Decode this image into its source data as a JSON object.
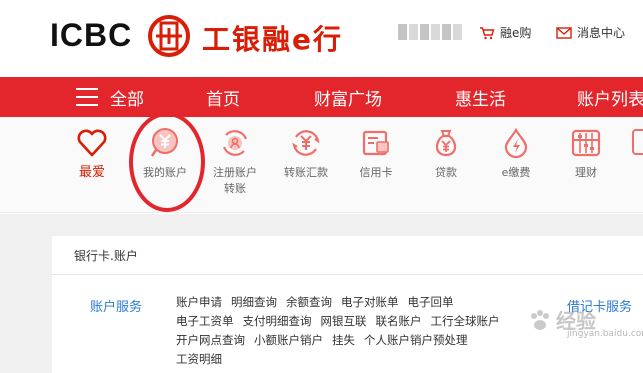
{
  "header": {
    "logo_text": "ICBC",
    "brand_cn": "工银融e行",
    "mall_link": "融e购",
    "messages_link": "消息中心"
  },
  "nav": {
    "all_label": "全部",
    "items": [
      "首页",
      "财富广场",
      "惠生活",
      "账户列表"
    ]
  },
  "quick_icons": [
    {
      "label": "最爱",
      "icon": "heart-icon"
    },
    {
      "label": "我的账户",
      "icon": "yuan-search-icon"
    },
    {
      "label": "注册账户转账",
      "line1": "注册账户",
      "line2": "转账",
      "icon": "register-transfer-icon"
    },
    {
      "label": "转账汇款",
      "icon": "transfer-icon"
    },
    {
      "label": "信用卡",
      "icon": "credit-card-icon"
    },
    {
      "label": "贷款",
      "icon": "money-bag-icon"
    },
    {
      "label": "e缴费",
      "icon": "drop-bolt-icon"
    },
    {
      "label": "理财",
      "icon": "abacus-icon"
    }
  ],
  "panel": {
    "title": "银行卡.账户",
    "left_section": "账户服务",
    "right_section": "借记卡服务",
    "rows": [
      [
        "账户申请",
        "明细查询",
        "余额查询",
        "电子对账单",
        "电子回单"
      ],
      [
        "电子工资单",
        "支付明细查询",
        "网银互联",
        "联名账户",
        "工行全球账户"
      ],
      [
        "开户网点查询",
        "小额账户销户",
        "挂失",
        "个人账户销户预处理"
      ],
      [
        "工资明细"
      ]
    ]
  },
  "watermark": {
    "text": "经验",
    "sub": "jingyan.baidu.com"
  },
  "colors": {
    "brand_red": "#e3262b",
    "link_blue": "#2b7bd1",
    "icon_red": "#ee6f6a"
  }
}
